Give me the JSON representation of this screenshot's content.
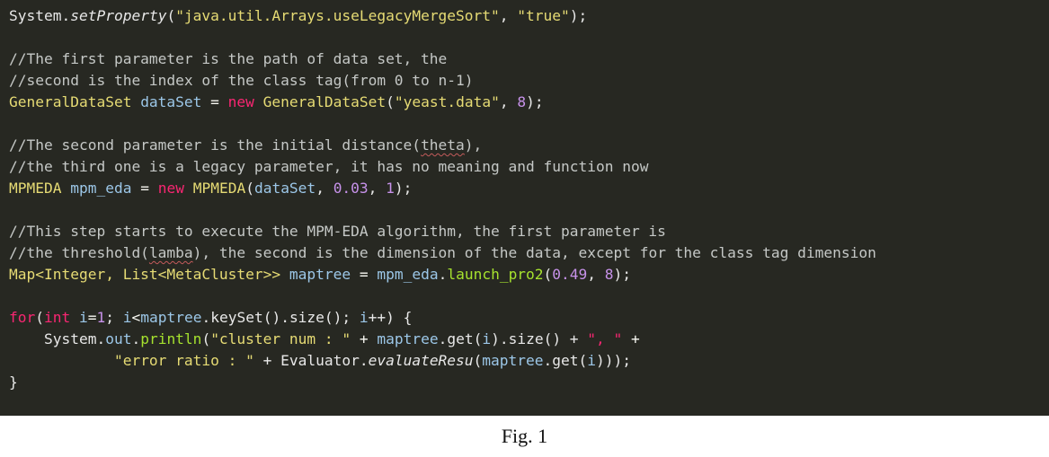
{
  "code_lines": [
    [
      {
        "text": "System.",
        "style": "plain"
      },
      {
        "text": "setProperty",
        "style": "italic"
      },
      {
        "text": "(",
        "style": "plain"
      },
      {
        "text": "\"java.util.Arrays.useLegacyMergeSort\"",
        "style": "string"
      },
      {
        "text": ", ",
        "style": "plain"
      },
      {
        "text": "\"true\"",
        "style": "string"
      },
      {
        "text": ");",
        "style": "plain"
      }
    ],
    [],
    [
      {
        "text": "//The first parameter is the path of data set, the",
        "style": "comment"
      }
    ],
    [
      {
        "text": "//second is the index of the class tag(from 0 to n-1)",
        "style": "comment"
      }
    ],
    [
      {
        "text": "GeneralDataSet ",
        "style": "class"
      },
      {
        "text": "dataSet",
        "style": "ident"
      },
      {
        "text": " = ",
        "style": "operator"
      },
      {
        "text": "new",
        "style": "keyword"
      },
      {
        "text": " ",
        "style": "plain"
      },
      {
        "text": "GeneralDataSet",
        "style": "class"
      },
      {
        "text": "(",
        "style": "plain"
      },
      {
        "text": "\"yeast.data\"",
        "style": "string"
      },
      {
        "text": ", ",
        "style": "plain"
      },
      {
        "text": "8",
        "style": "number"
      },
      {
        "text": ");",
        "style": "plain"
      }
    ],
    [],
    [
      {
        "text": "//The second parameter is the initial distance(",
        "style": "comment"
      },
      {
        "text": "theta",
        "style": "comment-squiggle"
      },
      {
        "text": "),",
        "style": "comment"
      }
    ],
    [
      {
        "text": "//the third one is a legacy parameter, it has no meaning and function now",
        "style": "comment"
      }
    ],
    [
      {
        "text": "MPMEDA ",
        "style": "class"
      },
      {
        "text": "mpm_eda",
        "style": "ident"
      },
      {
        "text": " = ",
        "style": "operator"
      },
      {
        "text": "new",
        "style": "keyword"
      },
      {
        "text": " ",
        "style": "plain"
      },
      {
        "text": "MPMEDA",
        "style": "class"
      },
      {
        "text": "(",
        "style": "plain"
      },
      {
        "text": "dataSet",
        "style": "ident"
      },
      {
        "text": ", ",
        "style": "plain"
      },
      {
        "text": "0.03",
        "style": "number"
      },
      {
        "text": ", ",
        "style": "plain"
      },
      {
        "text": "1",
        "style": "number"
      },
      {
        "text": ");",
        "style": "plain"
      }
    ],
    [],
    [
      {
        "text": "//This step starts to execute the MPM-EDA algorithm, the first parameter is",
        "style": "comment"
      }
    ],
    [
      {
        "text": "//the threshold(",
        "style": "comment"
      },
      {
        "text": "lamba",
        "style": "comment-squiggle"
      },
      {
        "text": "), the second is the dimension of the data, except for the class tag dimension",
        "style": "comment"
      }
    ],
    [
      {
        "text": "Map<Integer, List<MetaCluster>> ",
        "style": "class"
      },
      {
        "text": "maptree",
        "style": "ident"
      },
      {
        "text": " = ",
        "style": "operator"
      },
      {
        "text": "mpm_eda",
        "style": "ident"
      },
      {
        "text": ".",
        "style": "plain"
      },
      {
        "text": "launch_pro2",
        "style": "method"
      },
      {
        "text": "(",
        "style": "plain"
      },
      {
        "text": "0.49",
        "style": "number"
      },
      {
        "text": ", ",
        "style": "plain"
      },
      {
        "text": "8",
        "style": "number"
      },
      {
        "text": ");",
        "style": "plain"
      }
    ],
    [],
    [
      {
        "text": "for",
        "style": "keyword"
      },
      {
        "text": "(",
        "style": "plain"
      },
      {
        "text": "int",
        "style": "keyword"
      },
      {
        "text": " ",
        "style": "plain"
      },
      {
        "text": "i",
        "style": "ident"
      },
      {
        "text": "=",
        "style": "operator"
      },
      {
        "text": "1",
        "style": "number"
      },
      {
        "text": "; ",
        "style": "plain"
      },
      {
        "text": "i",
        "style": "ident"
      },
      {
        "text": "<",
        "style": "operator"
      },
      {
        "text": "maptree",
        "style": "ident"
      },
      {
        "text": ".keySet().size(); ",
        "style": "plain"
      },
      {
        "text": "i",
        "style": "ident"
      },
      {
        "text": "++) {",
        "style": "plain"
      }
    ],
    [
      {
        "text": "    System.",
        "style": "plain"
      },
      {
        "text": "out",
        "style": "ident"
      },
      {
        "text": ".",
        "style": "plain"
      },
      {
        "text": "println",
        "style": "method"
      },
      {
        "text": "(",
        "style": "plain"
      },
      {
        "text": "\"cluster num : \"",
        "style": "string"
      },
      {
        "text": " + ",
        "style": "operator"
      },
      {
        "text": "maptree",
        "style": "ident"
      },
      {
        "text": ".get(",
        "style": "plain"
      },
      {
        "text": "i",
        "style": "ident"
      },
      {
        "text": ").size() + ",
        "style": "plain"
      },
      {
        "text": "\", \"",
        "style": "keyword"
      },
      {
        "text": " +",
        "style": "operator"
      }
    ],
    [
      {
        "text": "            ",
        "style": "plain"
      },
      {
        "text": "\"error ratio : \"",
        "style": "string"
      },
      {
        "text": " + Evaluator.",
        "style": "plain"
      },
      {
        "text": "evaluateResu",
        "style": "italic"
      },
      {
        "text": "(",
        "style": "plain"
      },
      {
        "text": "maptree",
        "style": "ident"
      },
      {
        "text": ".get(",
        "style": "plain"
      },
      {
        "text": "i",
        "style": "ident"
      },
      {
        "text": ")));",
        "style": "plain"
      }
    ],
    [
      {
        "text": "}",
        "style": "plain"
      }
    ]
  ],
  "caption": "Fig. 1"
}
